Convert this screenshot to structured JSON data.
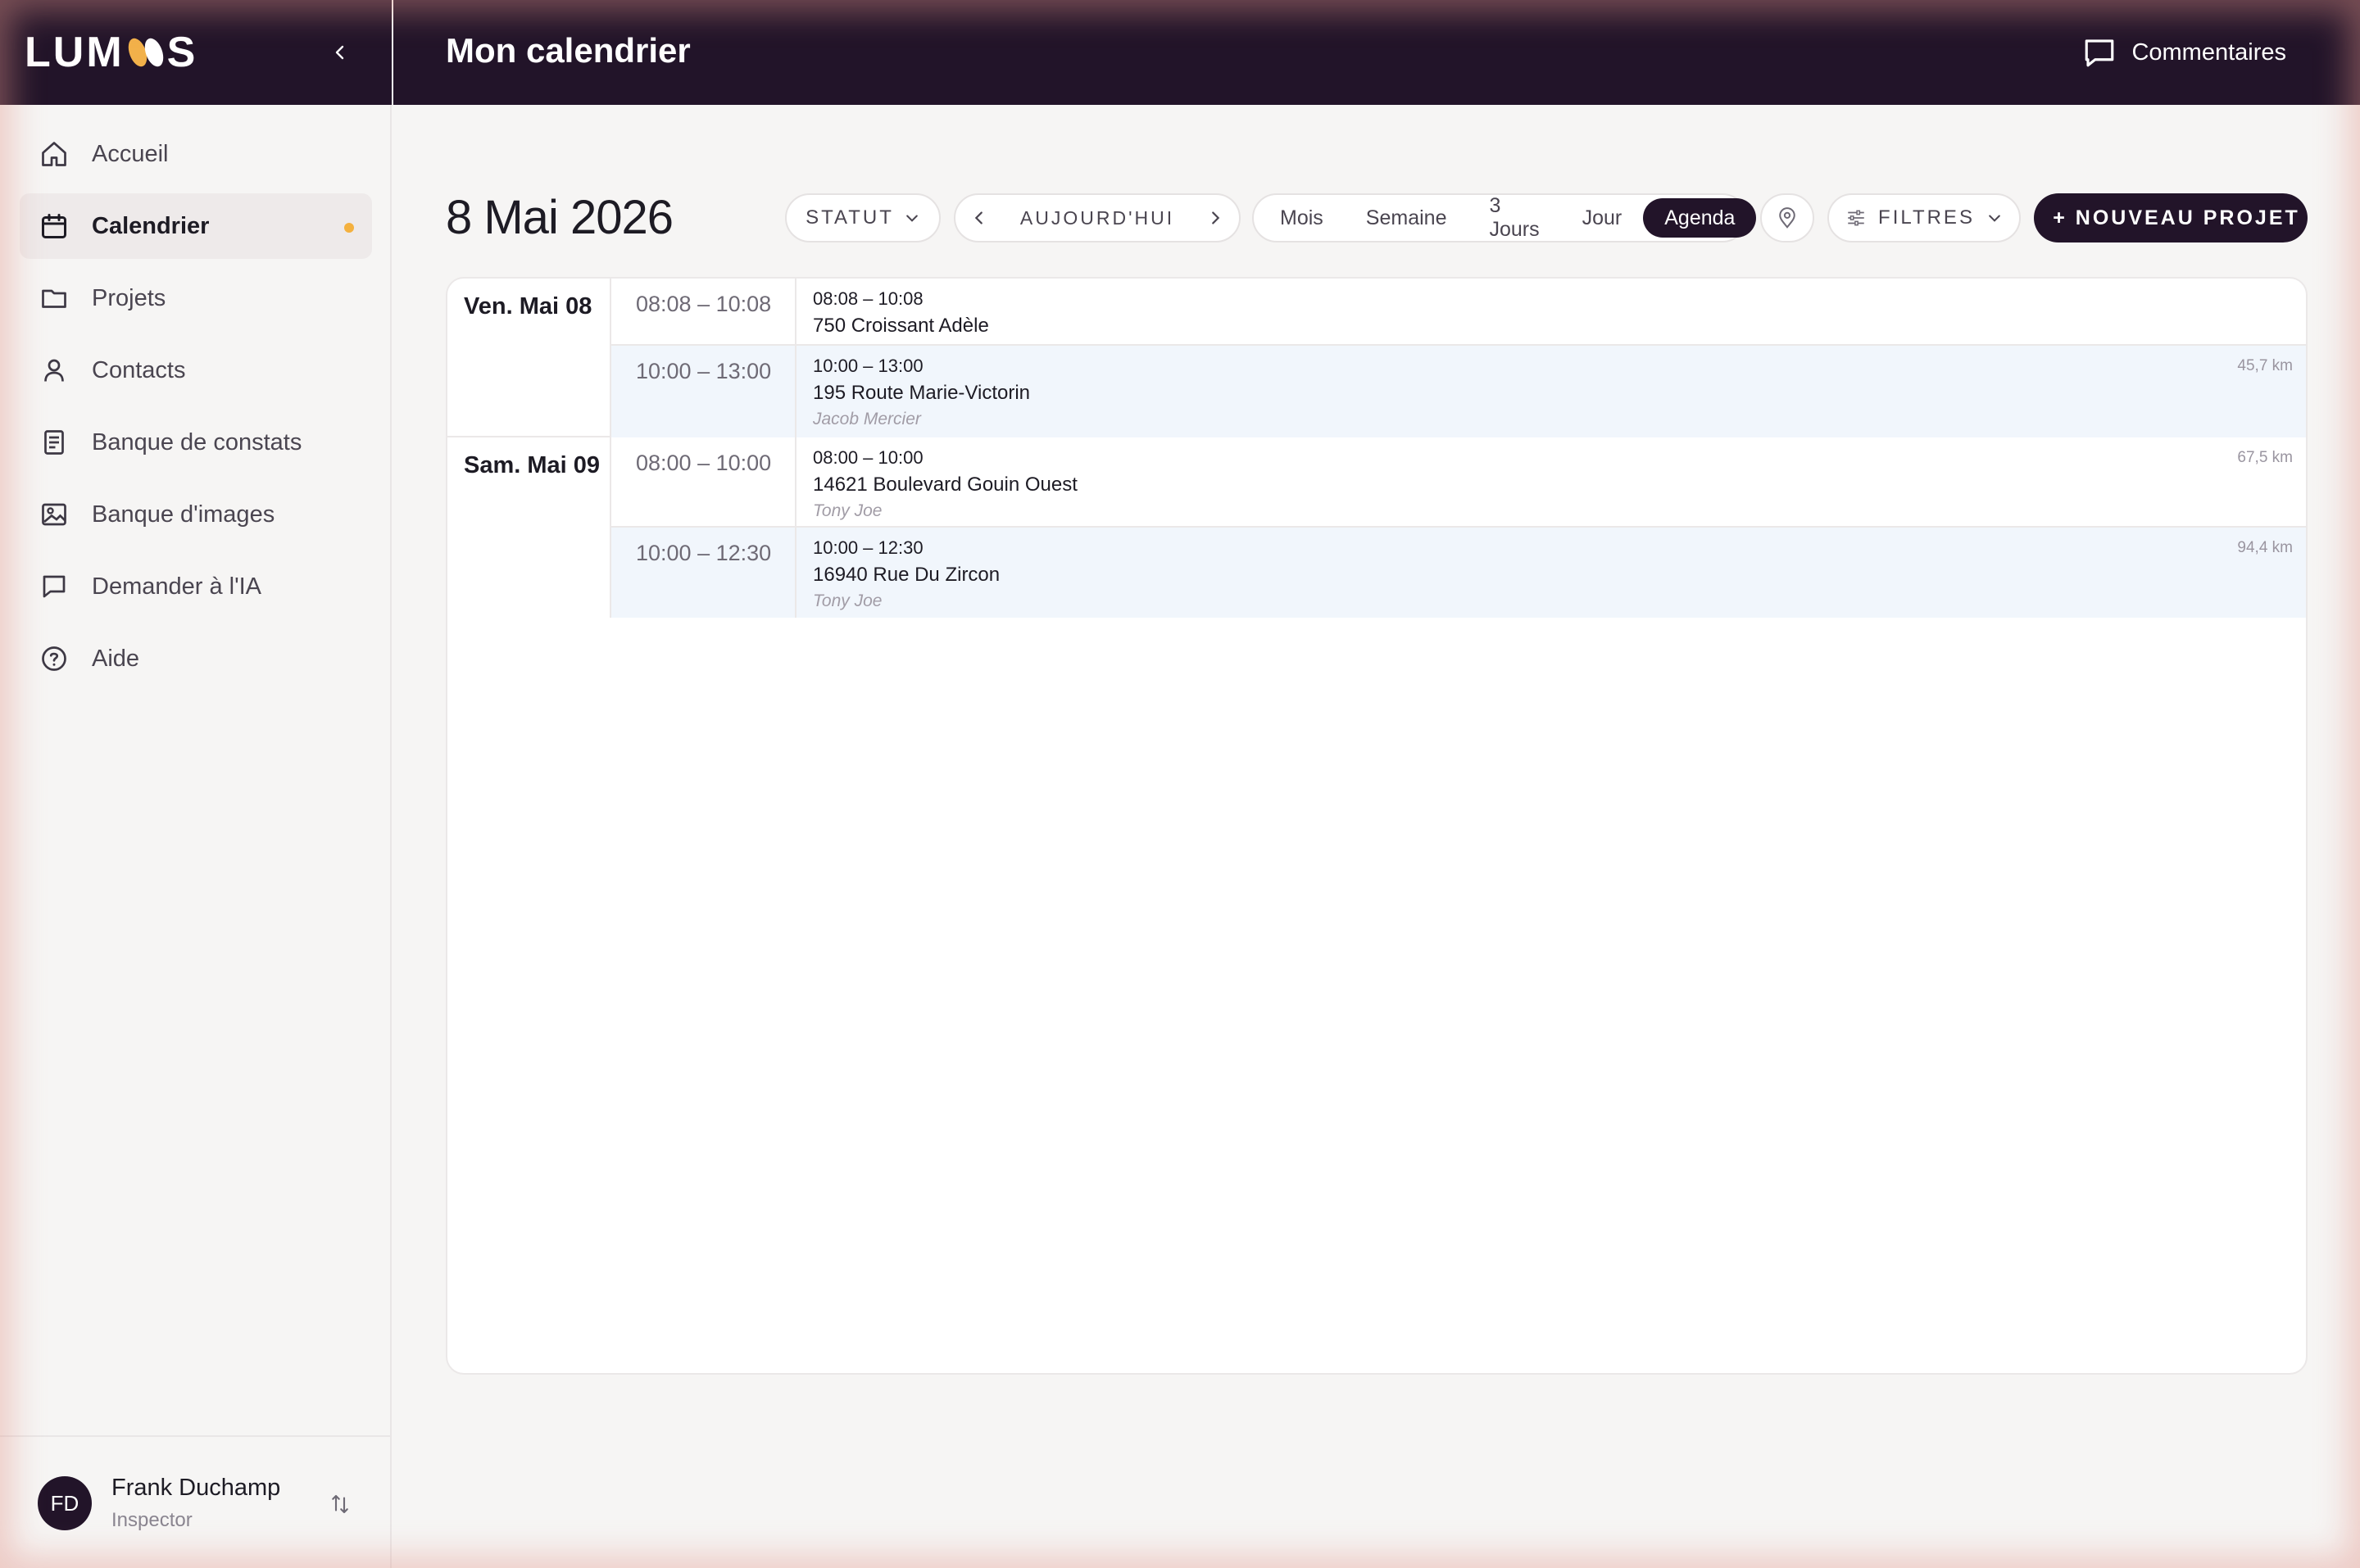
{
  "app": {
    "logo_left": "LUM",
    "logo_right": "S"
  },
  "header": {
    "title": "Mon calendrier",
    "comments_label": "Commentaires"
  },
  "sidebar": {
    "items": [
      {
        "label": "Accueil",
        "icon": "home-icon"
      },
      {
        "label": "Calendrier",
        "icon": "calendar-icon",
        "active": true
      },
      {
        "label": "Projets",
        "icon": "folder-icon"
      },
      {
        "label": "Contacts",
        "icon": "person-icon"
      },
      {
        "label": "Banque de constats",
        "icon": "document-icon"
      },
      {
        "label": "Banque d'images",
        "icon": "image-icon"
      },
      {
        "label": "Demander à l'IA",
        "icon": "chat-icon"
      },
      {
        "label": "Aide",
        "icon": "help-icon"
      }
    ],
    "user": {
      "initials": "FD",
      "name": "Frank Duchamp",
      "role": "Inspector"
    }
  },
  "toolbar": {
    "date": "8 Mai 2026",
    "status_label": "STATUT",
    "today_label": "AUJOURD'HUI",
    "views": [
      "Mois",
      "Semaine",
      "3 Jours",
      "Jour",
      "Agenda"
    ],
    "active_view": "Agenda",
    "filters_label": "FILTRES",
    "new_project_label": "+ NOUVEAU PROJET"
  },
  "agenda": {
    "days": [
      {
        "label": "Ven. Mai 08",
        "events": [
          {
            "range": "08:08 – 10:08",
            "time": "08:08 – 10:08",
            "address": "750 Croissant Adèle",
            "person": "",
            "distance": ""
          },
          {
            "range": "10:00 – 13:00",
            "time": "10:00 – 13:00",
            "address": "195 Route Marie-Victorin",
            "person": "Jacob Mercier",
            "distance": "45,7 km"
          }
        ]
      },
      {
        "label": "Sam. Mai 09",
        "events": [
          {
            "range": "08:00 – 10:00",
            "time": "08:00 – 10:00",
            "address": "14621 Boulevard Gouin Ouest",
            "person": "Tony Joe",
            "distance": "67,5 km"
          },
          {
            "range": "10:00 – 12:30",
            "time": "10:00 – 12:30",
            "address": "16940 Rue Du Zircon",
            "person": "Tony Joe",
            "distance": "94,4 km"
          }
        ]
      }
    ]
  },
  "colors": {
    "dark": "#221429",
    "accent": "#f4b13f",
    "shaded_row": "#f1f6fc"
  }
}
